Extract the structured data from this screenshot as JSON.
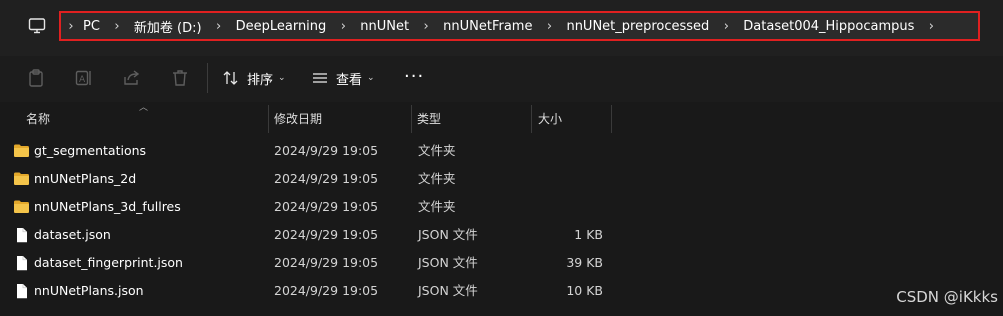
{
  "breadcrumb": [
    "PC",
    "新加卷 (D:)",
    "DeepLearning",
    "nnUNet",
    "nnUNetFrame",
    "nnUNet_preprocessed",
    "Dataset004_Hippocampus"
  ],
  "toolbar": {
    "sort_label": "排序",
    "view_label": "查看",
    "more_label": "···"
  },
  "columns": {
    "name": "名称",
    "date": "修改日期",
    "type": "类型",
    "size": "大小"
  },
  "files": [
    {
      "name": "gt_segmentations",
      "date": "2024/9/29 19:05",
      "type": "文件夹",
      "size": "",
      "icon": "folder-icon"
    },
    {
      "name": "nnUNetPlans_2d",
      "date": "2024/9/29 19:05",
      "type": "文件夹",
      "size": "",
      "icon": "folder-icon"
    },
    {
      "name": "nnUNetPlans_3d_fullres",
      "date": "2024/9/29 19:05",
      "type": "文件夹",
      "size": "",
      "icon": "folder-icon"
    },
    {
      "name": "dataset.json",
      "date": "2024/9/29 19:05",
      "type": "JSON 文件",
      "size": "1 KB",
      "icon": "file-icon"
    },
    {
      "name": "dataset_fingerprint.json",
      "date": "2024/9/29 19:05",
      "type": "JSON 文件",
      "size": "39 KB",
      "icon": "file-icon"
    },
    {
      "name": "nnUNetPlans.json",
      "date": "2024/9/29 19:05",
      "type": "JSON 文件",
      "size": "10 KB",
      "icon": "file-icon"
    }
  ],
  "watermark": "CSDN @iKkks",
  "colors": {
    "background": "#191919",
    "highlight_border": "#e02020",
    "folder": "#f0c040"
  }
}
